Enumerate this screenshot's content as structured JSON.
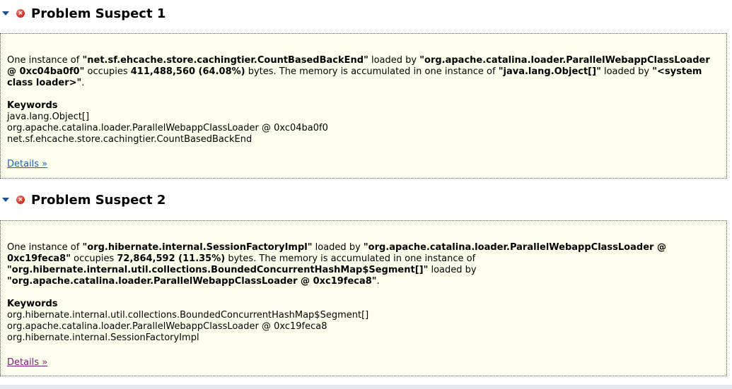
{
  "suspects": [
    {
      "title": "Problem Suspect 1",
      "desc": {
        "t1": "One instance of ",
        "b1": "\"net.sf.ehcache.store.cachingtier.CountBasedBackEnd\"",
        "t2": " loaded by ",
        "b2": "\"org.apache.catalina.loader.ParallelWebappClassLoader @ 0xc04ba0f0\"",
        "t3": " occupies ",
        "b3": "411,488,560 (64.08%)",
        "t4": " bytes. The memory is accumulated in one instance of ",
        "b4": "\"java.lang.Object[]\"",
        "t5": " loaded by ",
        "b5": "\"<system class loader>\"",
        "t6": "."
      },
      "keywords_label": "Keywords",
      "keywords": [
        "java.lang.Object[]",
        "org.apache.catalina.loader.ParallelWebappClassLoader @ 0xc04ba0f0",
        "net.sf.ehcache.store.cachingtier.CountBasedBackEnd"
      ],
      "details_label": "Details »"
    },
    {
      "title": "Problem Suspect 2",
      "desc": {
        "t1": "One instance of ",
        "b1": "\"org.hibernate.internal.SessionFactoryImpl\"",
        "t2": " loaded by ",
        "b2": "\"org.apache.catalina.loader.ParallelWebappClassLoader @ 0xc19feca8\"",
        "t3": " occupies ",
        "b3": "72,864,592 (11.35%)",
        "t4": " bytes. The memory is accumulated in one instance of ",
        "b4": "\"org.hibernate.internal.util.collections.BoundedConcurrentHashMap$Segment[]\"",
        "t5": " loaded by ",
        "b5": "\"org.apache.catalina.loader.ParallelWebappClassLoader @ 0xc19feca8\"",
        "t6": "."
      },
      "keywords_label": "Keywords",
      "keywords": [
        "org.hibernate.internal.util.collections.BoundedConcurrentHashMap$Segment[]",
        "org.apache.catalina.loader.ParallelWebappClassLoader @ 0xc19feca8",
        "org.hibernate.internal.SessionFactoryImpl"
      ],
      "details_label": "Details »"
    }
  ],
  "icons": {
    "collapse": "collapse-arrow-icon",
    "error": "error-icon"
  },
  "colors": {
    "box_background": "#ffffee",
    "link": "#1a5fb4",
    "link_visited": "#7a1a7a",
    "error": "#d43a2a"
  }
}
